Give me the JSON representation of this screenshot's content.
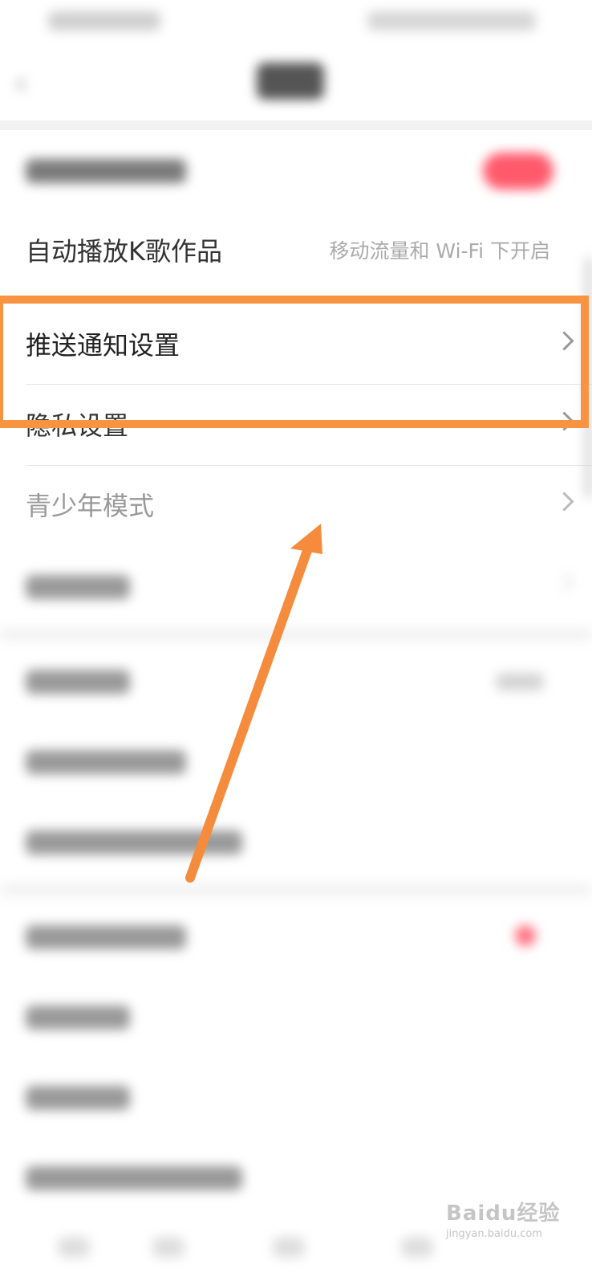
{
  "settings": {
    "autoplay": {
      "label": "自动播放K歌作品",
      "value": "移动流量和 Wi-Fi 下开启"
    },
    "push": {
      "label": "推送通知设置"
    },
    "privacy": {
      "label": "隐私设置"
    },
    "teen": {
      "label": "青少年模式"
    }
  },
  "colors": {
    "highlight": "#f79341",
    "arrow": "#f58c3d",
    "toggle_on": "#ff5a6c",
    "background": "#ffffff"
  },
  "watermark": {
    "brand": "Baidu经验",
    "site": "jingyan.baidu.com"
  },
  "icons": [
    "chevron-right-icon",
    "back-arrow-icon",
    "annotation-arrow"
  ]
}
